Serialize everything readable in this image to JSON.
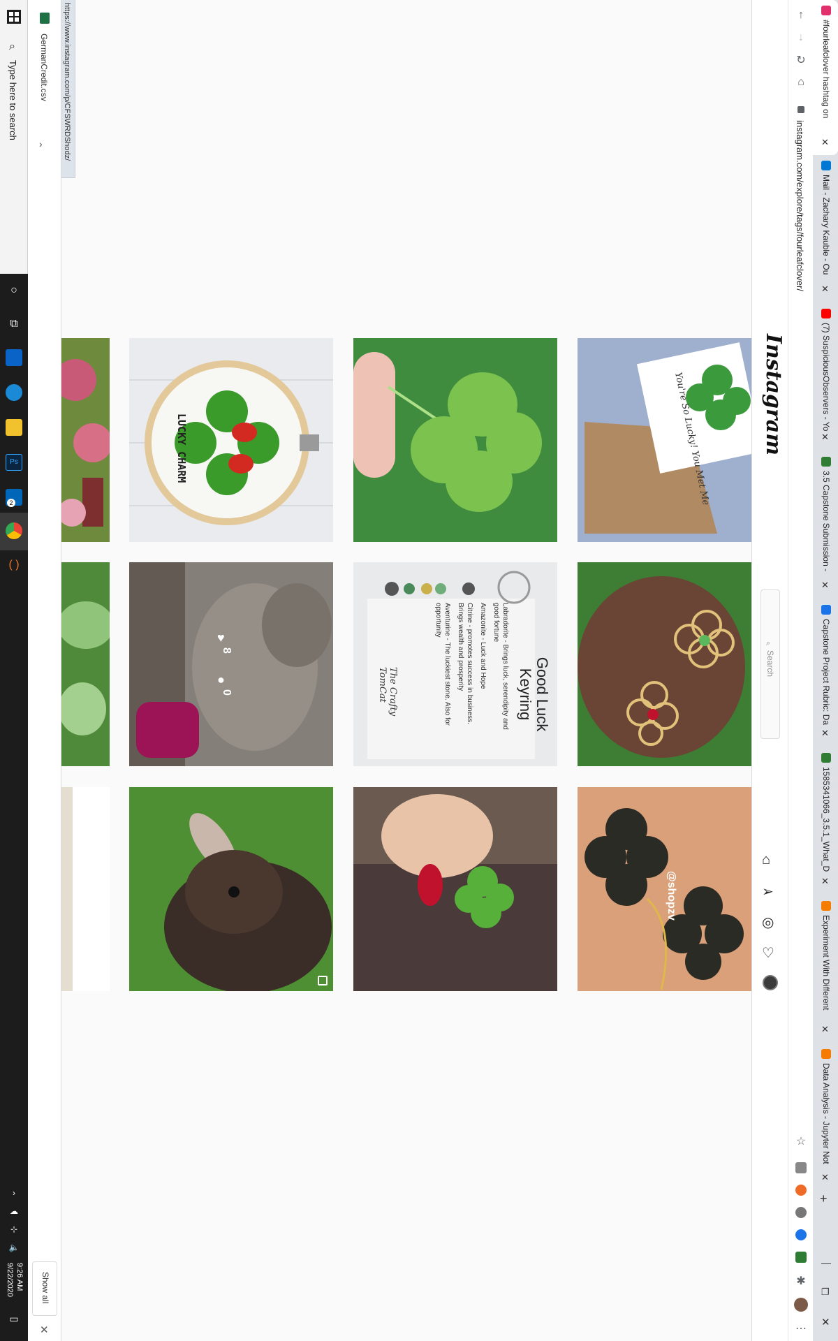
{
  "taskbar": {
    "search_placeholder": "Type here to search",
    "time": "9:26 AM",
    "date": "9/22/2020",
    "edge_badge": "2"
  },
  "downloads": {
    "file_name": "GermanCredit.csv",
    "show_all": "Show all",
    "status_url": "https://www.instagram.com/p/CFSWRDShodz/"
  },
  "browser": {
    "address": "instagram.com/explore/tags/fourleafclover/",
    "tabs": [
      {
        "title": "#fourleafclover hashtag on",
        "color": "#e1306c"
      },
      {
        "title": "Mail - Zachary Kauble - Ou",
        "color": "#0078d4"
      },
      {
        "title": "(7) SuspiciousObservers - Yo",
        "color": "#ff0000"
      },
      {
        "title": "3.5 Capstone Submission -",
        "color": "#2e7d32"
      },
      {
        "title": "Capstone Project Rubric: Da",
        "color": "#1a73e8"
      },
      {
        "title": "1585341066_3.5.1_What_D",
        "color": "#2e7d32"
      },
      {
        "title": "Experiment With Different",
        "color": "#f57c00"
      },
      {
        "title": "Data Analysis - Jupyter Not",
        "color": "#f57c00"
      }
    ]
  },
  "instagram": {
    "logo": "Instagram",
    "search_placeholder": "Search",
    "hover_likes": "8",
    "hover_comments": "0",
    "grid": [
      {
        "name": "lucky-charm-cross-stitch",
        "text": "LUCKY CHARM"
      },
      {
        "name": "clover-between-fingers",
        "text": ""
      },
      {
        "name": "lucky-card-envelope",
        "text": "You're So Lucky! You Met Me"
      },
      {
        "name": "garden-statue",
        "text": ""
      },
      {
        "name": "good-luck-keyring",
        "text": "Good Luck Keyring"
      },
      {
        "name": "clover-pendants-in-hand",
        "text": ""
      },
      {
        "name": "brown-bunny",
        "text": ""
      },
      {
        "name": "clover-red-nails",
        "text": ""
      },
      {
        "name": "black-clover-earrings",
        "text": "@shopzv"
      }
    ],
    "keyring_lines": [
      "Labradorite - Brings luck, serendipity and",
      "good fortune",
      "Amazonite - Luck and Hope",
      "Citrine - promotes success in business.",
      "Brings wealth and prosperity",
      "Aventurine - The luckiest stone. Also for",
      "opportunity"
    ],
    "keyring_brand": "The Crafty TomCat"
  },
  "colors": {
    "taskbar": "#1c1c1c",
    "tabstrip": "#dee1e6",
    "ig_bg": "#fafafa",
    "clover_green": "#3a9a2a"
  }
}
